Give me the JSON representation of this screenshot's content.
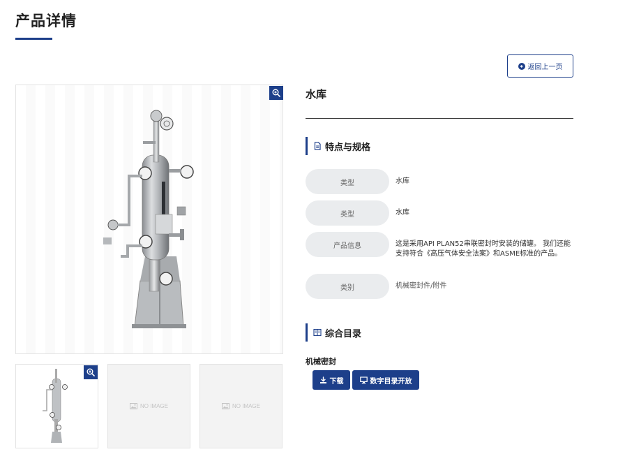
{
  "page": {
    "title": "产品详情"
  },
  "toolbar": {
    "back_label": "返回上一页"
  },
  "product": {
    "name": "水库"
  },
  "specs_section": {
    "title": "特点与规格",
    "rows": [
      {
        "label": "类型",
        "value": "水库"
      },
      {
        "label": "类型",
        "value": "水库"
      },
      {
        "label": "产品信息",
        "value": "这是采用API PLAN52串联密封时安装的储罐。 我们还能支持符合《高压气体安全法案》和ASME标准的产品。"
      },
      {
        "label": "类别",
        "value": "机械密封件/附件"
      }
    ]
  },
  "catalog_section": {
    "title": "综合目录",
    "subtitle": "机械密封",
    "download_label": "下载",
    "digital_label": "数字目录开放"
  },
  "gallery": {
    "placeholder_text": "NO IMAGE"
  },
  "colors": {
    "accent": "#1d3f8a",
    "pill": "#eaecee",
    "border": "#e3e3e3"
  },
  "icons": [
    "back-circle-arrow-icon",
    "zoom-in-icon",
    "document-icon",
    "book-icon",
    "download-icon",
    "monitor-icon",
    "image-icon"
  ]
}
